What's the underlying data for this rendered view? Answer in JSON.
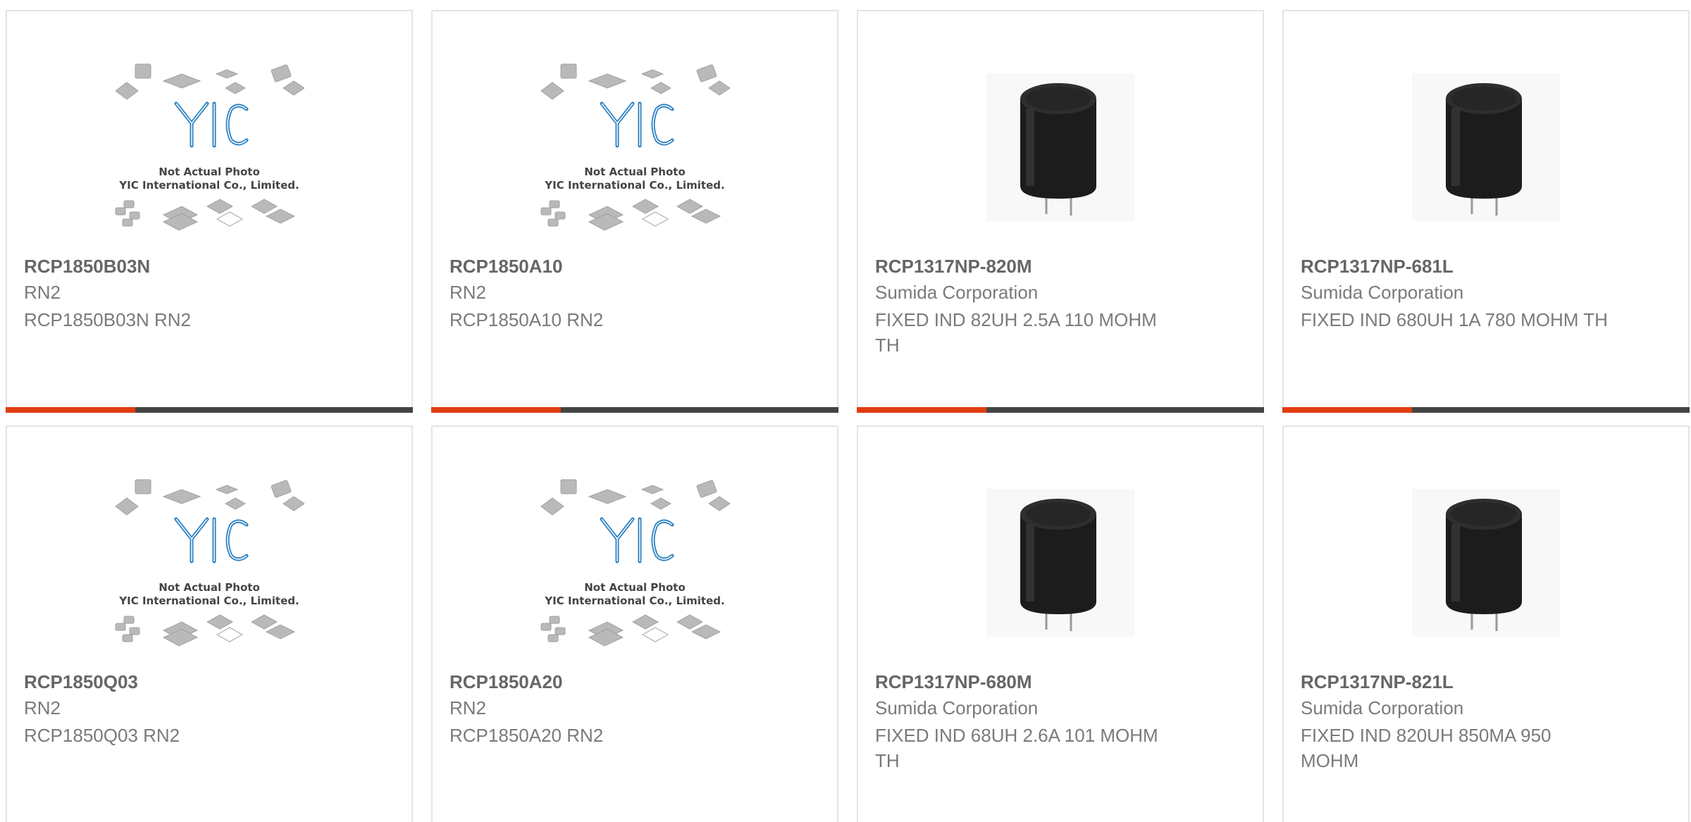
{
  "accent_color": "#e23c10",
  "bar_color": "#444444",
  "placeholder": {
    "logo_text": "YIC",
    "line1": "Not Actual Photo",
    "line2": "YIC International Co., Limited."
  },
  "products": [
    {
      "part": "RCP1850B03N",
      "manufacturer": "RN2",
      "description": "RCP1850B03N RN2",
      "image": "placeholder-chip-icon"
    },
    {
      "part": "RCP1850A10",
      "manufacturer": "RN2",
      "description": "RCP1850A10 RN2",
      "image": "placeholder-chip-icon"
    },
    {
      "part": "RCP1317NP-820M",
      "manufacturer": "Sumida Corporation",
      "description": "FIXED IND 82UH 2.5A 110 MOHM TH",
      "image": "inductor-photo-icon"
    },
    {
      "part": "RCP1317NP-681L",
      "manufacturer": "Sumida Corporation",
      "description": "FIXED IND 680UH 1A 780 MOHM TH",
      "image": "inductor-photo-icon"
    },
    {
      "part": "RCP1850Q03",
      "manufacturer": "RN2",
      "description": "RCP1850Q03 RN2",
      "image": "placeholder-chip-icon"
    },
    {
      "part": "RCP1850A20",
      "manufacturer": "RN2",
      "description": "RCP1850A20 RN2",
      "image": "placeholder-chip-icon"
    },
    {
      "part": "RCP1317NP-680M",
      "manufacturer": "Sumida Corporation",
      "description": "FIXED IND 68UH 2.6A 101 MOHM TH",
      "image": "inductor-photo-icon"
    },
    {
      "part": "RCP1317NP-821L",
      "manufacturer": "Sumida Corporation",
      "description": "FIXED IND 820UH 850MA 950 MOHM",
      "image": "inductor-photo-icon"
    }
  ]
}
